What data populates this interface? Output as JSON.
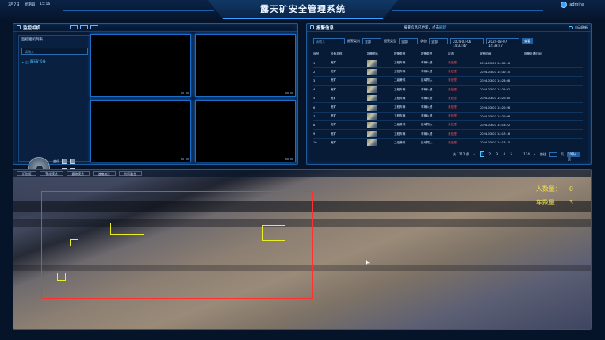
{
  "header": {
    "date": "3月7日",
    "weekday": "星期四",
    "time": "15:16",
    "title": "露天矿安全管理系统",
    "username": "admina"
  },
  "monitor": {
    "title": "监控相机",
    "tree_title": "监控相机列表",
    "search_placeholder": "请输入",
    "tree_item": "露天矿设备",
    "ctrl_zoom_label": "变倍",
    "ctrl_focus_label": "聚焦"
  },
  "alarm": {
    "title": "报警信息",
    "notice": "报警信息已更新，点击",
    "notice_link": "刷新",
    "auto_refresh": "自动刷新",
    "filters": {
      "search_placeholder": "请输入",
      "type_label": "报警类别",
      "type_value": "全部",
      "level_label": "报警类型",
      "level_value": "全部",
      "status_label": "状态",
      "status_value": "全部",
      "date_from": "2024-03-06 14:33:47",
      "date_to": "2024-03-07 14:33:47",
      "query": "查看"
    },
    "columns": [
      "序号",
      "设备名称",
      "报警图片",
      "报警类别",
      "报警类型",
      "状态",
      "报警时间",
      "报警处理时间"
    ],
    "rows": [
      {
        "no": "1",
        "device": "宽矿",
        "cat": "工程车辆",
        "type": "车辆入侵",
        "status": "未处理",
        "time": "2024-03-07 14:30:16"
      },
      {
        "no": "2",
        "device": "宽矿",
        "cat": "工程车辆",
        "type": "车辆入侵",
        "status": "未处理",
        "time": "2024-03-07 14:30:10"
      },
      {
        "no": "3",
        "device": "宽矿",
        "cat": "二级警戒",
        "type": "区域闯入",
        "status": "未处理",
        "time": "2024-03-07 14:26:08"
      },
      {
        "no": "4",
        "device": "宽矿",
        "cat": "工程车辆",
        "type": "车辆入侵",
        "status": "未处理",
        "time": "2024-03-07 14:25:02"
      },
      {
        "no": "5",
        "device": "宽矿",
        "cat": "工程车辆",
        "type": "车辆入侵",
        "status": "未处理",
        "time": "2024-03-07 14:20:30"
      },
      {
        "no": "6",
        "device": "宽矿",
        "cat": "工程车辆",
        "type": "车辆入侵",
        "status": "未处理",
        "time": "2024-03-07 14:20:26"
      },
      {
        "no": "7",
        "device": "宽矿",
        "cat": "工程车辆",
        "type": "车辆入侵",
        "status": "未处理",
        "time": "2024-03-07 14:20:08"
      },
      {
        "no": "8",
        "device": "宽矿",
        "cat": "二级警戒",
        "type": "区域闯入",
        "status": "未处理",
        "time": "2024-03-07 14:18:22"
      },
      {
        "no": "9",
        "device": "宽矿",
        "cat": "工程车辆",
        "type": "车辆入侵",
        "status": "未处理",
        "time": "2024-03-07 14:17:16"
      },
      {
        "no": "10",
        "device": "宽矿",
        "cat": "二级警戒",
        "type": "区域闯入",
        "status": "未处理",
        "time": "2024-03-07 14:17:10"
      }
    ],
    "pager": {
      "total": "共 1212 条",
      "prev": "‹",
      "pages": [
        "1",
        "2",
        "3",
        "4",
        "5",
        "...",
        "124"
      ],
      "next": "›",
      "goto": "前往",
      "page_unit": "页",
      "size": "10条/页"
    }
  },
  "live": {
    "tabs": [
      "识别框",
      "警戒模式",
      "跟踪模式",
      "速度加注",
      "时间监控"
    ],
    "person_label": "人数量：",
    "person_count": "0",
    "vehicle_label": "车数量：",
    "vehicle_count": "3"
  },
  "colors": {
    "accent": "#4fc3ff",
    "alarm_red": "#ff4f4f",
    "zone_red": "#ff3030",
    "detect_yellow": "#e9f021",
    "count_yellow": "#f0e24a"
  }
}
